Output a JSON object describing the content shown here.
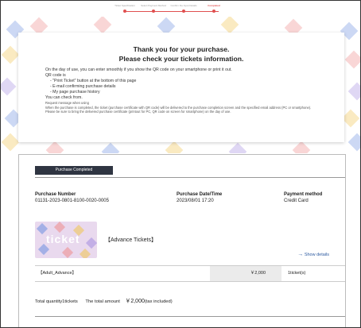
{
  "steps": [
    {
      "label": "Ticket Specification",
      "active": false
    },
    {
      "label": "Select Payment Method",
      "active": false
    },
    {
      "label": "Confirm the Input Details",
      "active": false
    },
    {
      "label": "Completed",
      "active": true
    }
  ],
  "thanks": {
    "title_line1": "Thank you for your purchase.",
    "title_line2": "Please check your tickets information.",
    "intro": "On the day of use, you can enter smoothly if you show the QR code on your smartphone or print it out.",
    "qr_label": "QR code is",
    "bullets": [
      "- \"Print Ticket\" button at the bottom of this page",
      "- E-mail confirming purchase details",
      "- My page purchase history"
    ],
    "check_from": "You can check from.",
    "request_label": "Request message when using",
    "request_text": "When the purchase is completed, the ticket (purchase certificate with QR code) will be delivered to the purchase completion screen and the specified email address (PC or smartphone).",
    "bring_text": "Please be sure to bring the delivered purchase certificate (printout for PC, QR code on screen for smartphone) on the day of use."
  },
  "order": {
    "status_badge": "Purchase Completed",
    "purchase_number_label": "Purchase Number",
    "purchase_number": "01131-2023-0801-8100-0020-0005",
    "purchase_date_label": "Purchase Date/Time",
    "purchase_date": "2023/08/01 17:20",
    "payment_method_label": "Payment method",
    "payment_method": "Credit Card",
    "ticket_image_text": "ticket",
    "ticket_name": "【Advance Tickets】",
    "show_details": "Show details",
    "line_item": {
      "name": "【Adult_Advance】",
      "price": "￥2,000",
      "qty": "1ticket(s)"
    },
    "total_quantity_label": "Total quantity1tickets",
    "total_amount_label": "The total amount",
    "total_amount": "￥2,000",
    "tax_note": "(tax included)"
  },
  "colors": {
    "accent": "#e05050",
    "badge_bg": "#2f3542",
    "link": "#2c5aa0"
  }
}
